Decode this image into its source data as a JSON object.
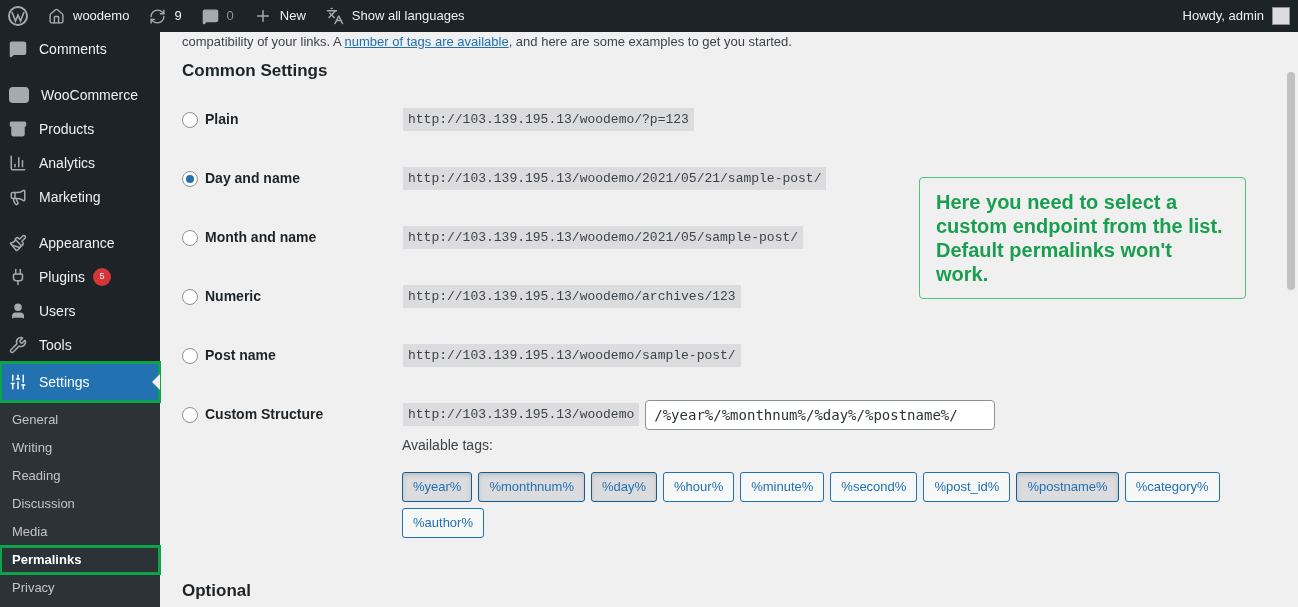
{
  "admin_bar": {
    "site": "woodemo",
    "updates": "9",
    "comments": "0",
    "new": "New",
    "languages": "Show all languages",
    "greeting": "Howdy, admin"
  },
  "sidebar": {
    "items": [
      {
        "label": "Comments",
        "selected": false,
        "highlighted": false
      },
      {
        "label": "WooCommerce",
        "selected": false,
        "highlighted": false
      },
      {
        "label": "Products",
        "selected": false,
        "highlighted": false
      },
      {
        "label": "Analytics",
        "selected": false,
        "highlighted": false
      },
      {
        "label": "Marketing",
        "selected": false,
        "highlighted": false
      },
      {
        "label": "Appearance",
        "selected": false,
        "highlighted": false
      },
      {
        "label": "Plugins",
        "selected": false,
        "highlighted": false,
        "badge": "5"
      },
      {
        "label": "Users",
        "selected": false,
        "highlighted": false
      },
      {
        "label": "Tools",
        "selected": false,
        "highlighted": false
      },
      {
        "label": "Settings",
        "selected": true,
        "highlighted": true
      }
    ],
    "submenu": [
      {
        "label": "General",
        "selected": false,
        "highlighted": false
      },
      {
        "label": "Writing",
        "selected": false,
        "highlighted": false
      },
      {
        "label": "Reading",
        "selected": false,
        "highlighted": false
      },
      {
        "label": "Discussion",
        "selected": false,
        "highlighted": false
      },
      {
        "label": "Media",
        "selected": false,
        "highlighted": false
      },
      {
        "label": "Permalinks",
        "selected": true,
        "highlighted": true
      },
      {
        "label": "Privacy",
        "selected": false,
        "highlighted": false
      }
    ]
  },
  "intro": {
    "before": "compatibility of your links. A ",
    "link": "number of tags are available",
    "after": ", and here are some examples to get you started."
  },
  "section_title": "Common Settings",
  "options": [
    {
      "label": "Plain",
      "url": "http://103.139.195.13/woodemo/?p=123",
      "selected": false
    },
    {
      "label": "Day and name",
      "url": "http://103.139.195.13/woodemo/2021/05/21/sample-post/",
      "selected": true
    },
    {
      "label": "Month and name",
      "url": "http://103.139.195.13/woodemo/2021/05/sample-post/",
      "selected": false
    },
    {
      "label": "Numeric",
      "url": "http://103.139.195.13/woodemo/archives/123",
      "selected": false
    },
    {
      "label": "Post name",
      "url": "http://103.139.195.13/woodemo/sample-post/",
      "selected": false
    },
    {
      "label": "Custom Structure",
      "url": "http://103.139.195.13/woodemo",
      "value": "/%year%/%monthnum%/%day%/%postname%/",
      "selected": false
    }
  ],
  "available_tags_label": "Available tags:",
  "tags": [
    {
      "label": "%year%",
      "selected": true
    },
    {
      "label": "%monthnum%",
      "selected": true
    },
    {
      "label": "%day%",
      "selected": true
    },
    {
      "label": "%hour%",
      "selected": false
    },
    {
      "label": "%minute%",
      "selected": false
    },
    {
      "label": "%second%",
      "selected": false
    },
    {
      "label": "%post_id%",
      "selected": false
    },
    {
      "label": "%postname%",
      "selected": true
    },
    {
      "label": "%category%",
      "selected": false
    },
    {
      "label": "%author%",
      "selected": false
    }
  ],
  "callout": "Here you need to select a custom endpoint from the list. Default permalinks won't work.",
  "optional_title": "Optional"
}
